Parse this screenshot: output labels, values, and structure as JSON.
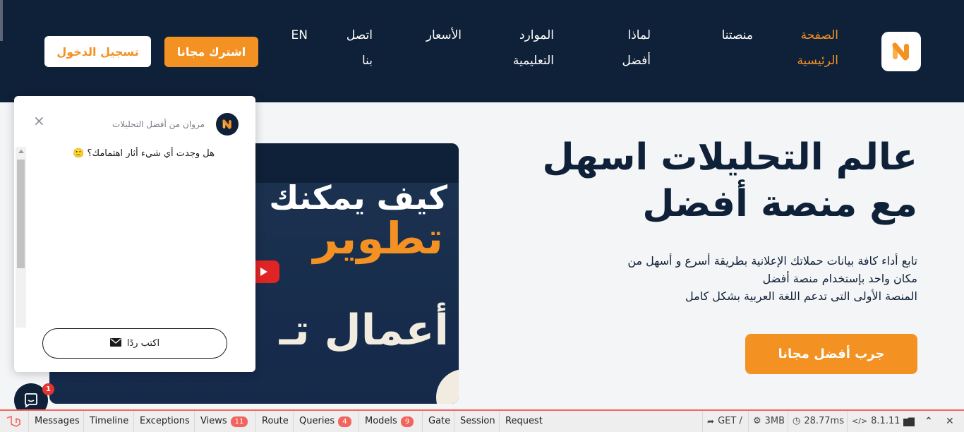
{
  "header": {
    "nav": [
      {
        "label": "الصفحة الرئيسية",
        "active": true
      },
      {
        "label": "منصتنا"
      },
      {
        "label": "لماذا أفضل"
      },
      {
        "label": "الموارد التعليمية"
      },
      {
        "label": "الأسعار"
      },
      {
        "label": "اتصل بنا"
      },
      {
        "label": "EN"
      }
    ],
    "signup_label": "اشترك مجانا",
    "login_label": "تسجيل الدخول"
  },
  "hero": {
    "title_line1": "عالم التحليلات اسهل",
    "title_line2": "مع منصة أفضل",
    "desc_line1": "تابع أداء كافة بيانات حملاتك الإعلانية بطريقة أسرع و أسهل من",
    "desc_line2": "مكان واحد بإستخدام منصة أفضل",
    "desc_line3": "المنصة الأولى التى تدعم اللغة العربية بشكل كامل",
    "cta_label": "جرب أفضل مجانا"
  },
  "video": {
    "line1": "كيف يمكنك",
    "line2": "تطوير",
    "line3": "أعمال تـ"
  },
  "chat": {
    "sender": "مروان من أفضل التحليلات",
    "message": "هل وجدت أي شيء أثار اهتمامك؟ 🙂",
    "reply_label": "اكتب ردًا",
    "close_symbol": "×",
    "launcher_badge": "1"
  },
  "debugbar": {
    "tabs": [
      {
        "label": "Messages"
      },
      {
        "label": "Timeline"
      },
      {
        "label": "Exceptions"
      },
      {
        "label": "Views",
        "badge": "11"
      },
      {
        "label": "Route"
      },
      {
        "label": "Queries",
        "badge": "4"
      },
      {
        "label": "Models",
        "badge": "9"
      },
      {
        "label": "Gate"
      },
      {
        "label": "Session"
      },
      {
        "label": "Request"
      }
    ],
    "method": "GET /",
    "memory": "3MB",
    "time": "28.77ms",
    "php_version": "8.1.11"
  },
  "colors": {
    "navy": "#0f2138",
    "orange": "#f39223",
    "debug_red": "#f4645f"
  },
  "icons": [
    "logo-icon",
    "play-icon",
    "close-icon",
    "envelope-icon",
    "chat-bubble-icon",
    "folder-icon",
    "chevron-up-icon",
    "close-x-icon",
    "clock-icon",
    "memory-icon",
    "code-icon",
    "arrow-icon"
  ]
}
